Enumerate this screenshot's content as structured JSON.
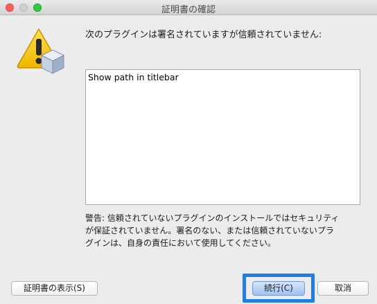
{
  "window": {
    "title": "証明書の確認"
  },
  "message": "次のプラグインは署名されていますが信頼されていません:",
  "plugins": [
    "Show path in titlebar"
  ],
  "warning": "警告: 信頼されていないプラグインのインストールではセキュリティ\nが保証されていません。署名のない、または信頼されていないプラ\nグインは、自身の責任において使用してください。",
  "buttons": {
    "show_certificate": "証明書の表示(S)",
    "continue": "続行(C)",
    "cancel": "取消"
  },
  "icon": "warning-plugin-icon",
  "colors": {
    "focus_ring": "#1e7fe8",
    "default_button": "#9fc2f2"
  }
}
